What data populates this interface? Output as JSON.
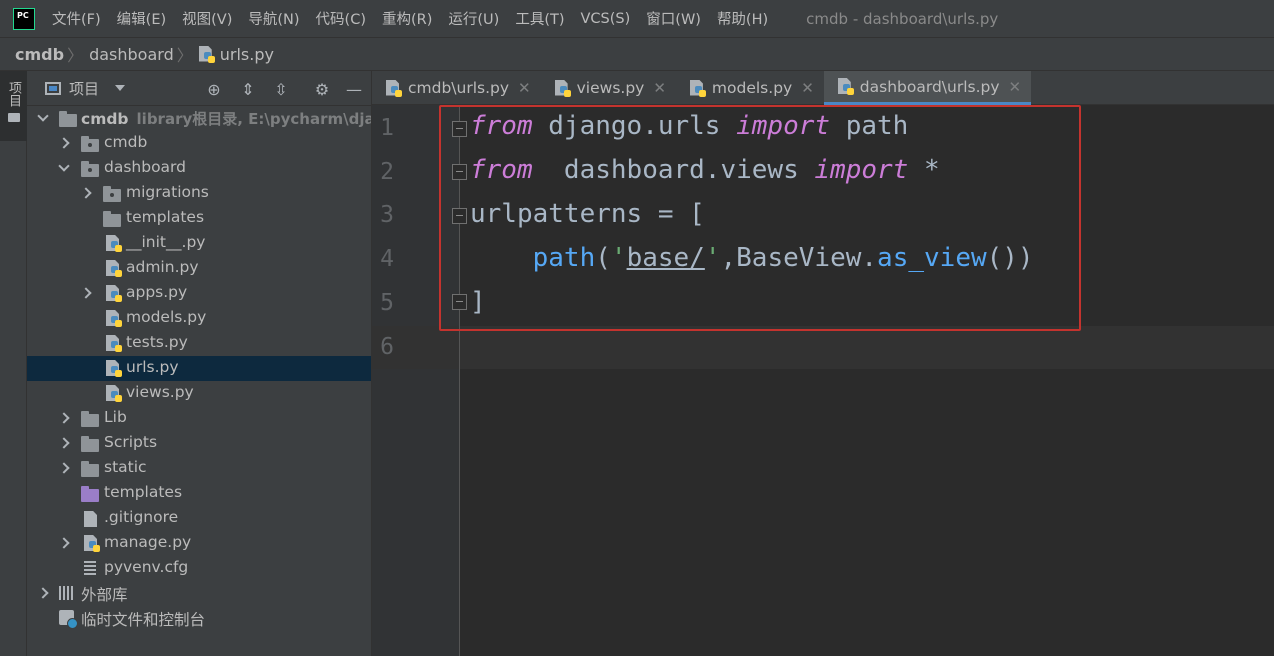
{
  "menubar": {
    "items": [
      "文件(F)",
      "编辑(E)",
      "视图(V)",
      "导航(N)",
      "代码(C)",
      "重构(R)",
      "运行(U)",
      "工具(T)",
      "VCS(S)",
      "窗口(W)",
      "帮助(H)"
    ],
    "window_title": "cmdb - dashboard\\urls.py",
    "logo_text": "PC"
  },
  "breadcrumb": {
    "root": "cmdb",
    "folder": "dashboard",
    "file": "urls.py"
  },
  "tool_strip": {
    "project_label": "项目"
  },
  "project_panel": {
    "title": "项目",
    "tree": {
      "root_name": "cmdb",
      "root_hint": "library根目录, E:\\pycharm\\django",
      "cmdb": "cmdb",
      "dashboard": "dashboard",
      "migrations": "migrations",
      "templates_inner": "templates",
      "init": "__init__.py",
      "admin": "admin.py",
      "apps": "apps.py",
      "models": "models.py",
      "tests": "tests.py",
      "urls": "urls.py",
      "views": "views.py",
      "lib": "Lib",
      "scripts": "Scripts",
      "static": "static",
      "templates": "templates",
      "gitignore": ".gitignore",
      "manage": "manage.py",
      "pyvenv": "pyvenv.cfg",
      "external_libs": "外部库",
      "scratches": "临时文件和控制台"
    }
  },
  "tabs": [
    {
      "label": "cmdb\\urls.py",
      "active": false
    },
    {
      "label": "views.py",
      "active": false
    },
    {
      "label": "models.py",
      "active": false
    },
    {
      "label": "dashboard\\urls.py",
      "active": true
    }
  ],
  "editor": {
    "line_numbers": [
      "1",
      "2",
      "3",
      "4",
      "5",
      "6"
    ],
    "code": {
      "l1_kw1": "from",
      "l1_mod": " django.urls ",
      "l1_kw2": "import",
      "l1_name": " path",
      "l2_kw1": "from",
      "l2_mod": "  dashboard.views ",
      "l2_kw2": "import",
      "l2_name": " *",
      "l3": "urlpatterns = [",
      "l4_indent": "    ",
      "l4_fn": "path",
      "l4_open": "(",
      "l4_q1": "'",
      "l4_str": "base/",
      "l4_q2": "'",
      "l4_mid": ",BaseView.",
      "l4_fn2": "as_view",
      "l4_close": "())",
      "l5": "]"
    },
    "accent_colors": {
      "keyword": "#cc7dd8",
      "function": "#56a8f5",
      "string": "#6aab73",
      "highlight_box": "#c4332e"
    }
  }
}
